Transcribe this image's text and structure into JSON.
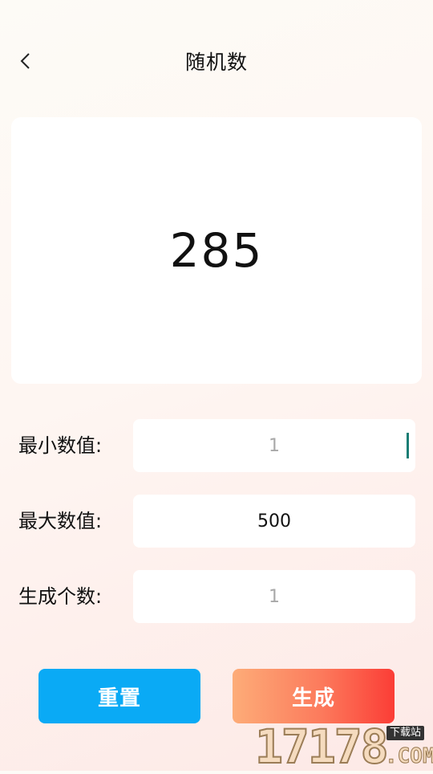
{
  "header": {
    "title": "随机数",
    "back_icon": "chevron-left-icon"
  },
  "result": {
    "value": "285"
  },
  "form": {
    "min": {
      "label": "最小数值:",
      "value": "",
      "placeholder": "1"
    },
    "max": {
      "label": "最大数值:",
      "value": "500",
      "placeholder": ""
    },
    "count": {
      "label": "生成个数:",
      "value": "",
      "placeholder": "1"
    }
  },
  "buttons": {
    "reset_label": "重置",
    "generate_label": "生成"
  },
  "colors": {
    "reset_button": "#0aaaf5",
    "generate_gradient_start": "#fdac78",
    "generate_gradient_end": "#fb3d36",
    "caret": "#1a7d74"
  },
  "watermark": {
    "digits": "17178",
    "tag": "下载站",
    "domain": ".COM"
  }
}
